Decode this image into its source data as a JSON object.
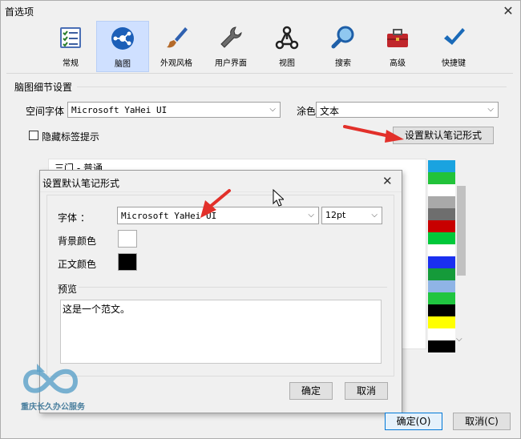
{
  "window": {
    "title": "首选项"
  },
  "toolbar": {
    "items": [
      {
        "label": "常规",
        "icon": "checklist-icon"
      },
      {
        "label": "脑图",
        "icon": "mindmap-icon"
      },
      {
        "label": "外观风格",
        "icon": "paintbrush-icon"
      },
      {
        "label": "用户界面",
        "icon": "wrench-icon"
      },
      {
        "label": "视图",
        "icon": "network-icon"
      },
      {
        "label": "搜索",
        "icon": "magnifier-icon"
      },
      {
        "label": "高级",
        "icon": "toolbox-icon"
      },
      {
        "label": "快捷键",
        "icon": "checkmark-icon"
      }
    ],
    "selected": "脑图"
  },
  "mindmap_settings": {
    "group_label": "脑图细节设置",
    "space_font_label": "空间字体",
    "space_font_value": "Microsoft YaHei UI",
    "paint_label": "涂色",
    "paint_value": "文本",
    "hide_tag_label": "隐藏标签提示",
    "set_default_button": "设置默认笔记形式",
    "preview_text": "三门 - 普通",
    "swatch_colors": [
      "#1aa3e0",
      "#22c33a",
      "#ffffff",
      "#a9a9a9",
      "#6e6e6e",
      "#c80000",
      "#00c83a",
      "#ffffff",
      "#1a2ff0",
      "#159b3a",
      "#8fb4e6",
      "#20c540",
      "#000000",
      "#ffff00",
      "#ffffff",
      "#000000"
    ]
  },
  "dialog": {
    "title": "设置默认笔记形式",
    "font_label": "字体",
    "font_colon": "：",
    "font_value": "Microsoft YaHei UI",
    "size_value": "12pt",
    "bg_color_label": "背景颜色",
    "text_color_label": "正文颜色",
    "bg_color": "#ffffff",
    "text_color": "#000000",
    "preview_label": "预览",
    "preview_text": "这是一个范文。",
    "ok_button": "确定",
    "cancel_button": "取消"
  },
  "footer": {
    "ok_button": "确定(O)",
    "cancel_button": "取消(C)"
  },
  "watermark": {
    "text": "重庆长久办公服务"
  }
}
